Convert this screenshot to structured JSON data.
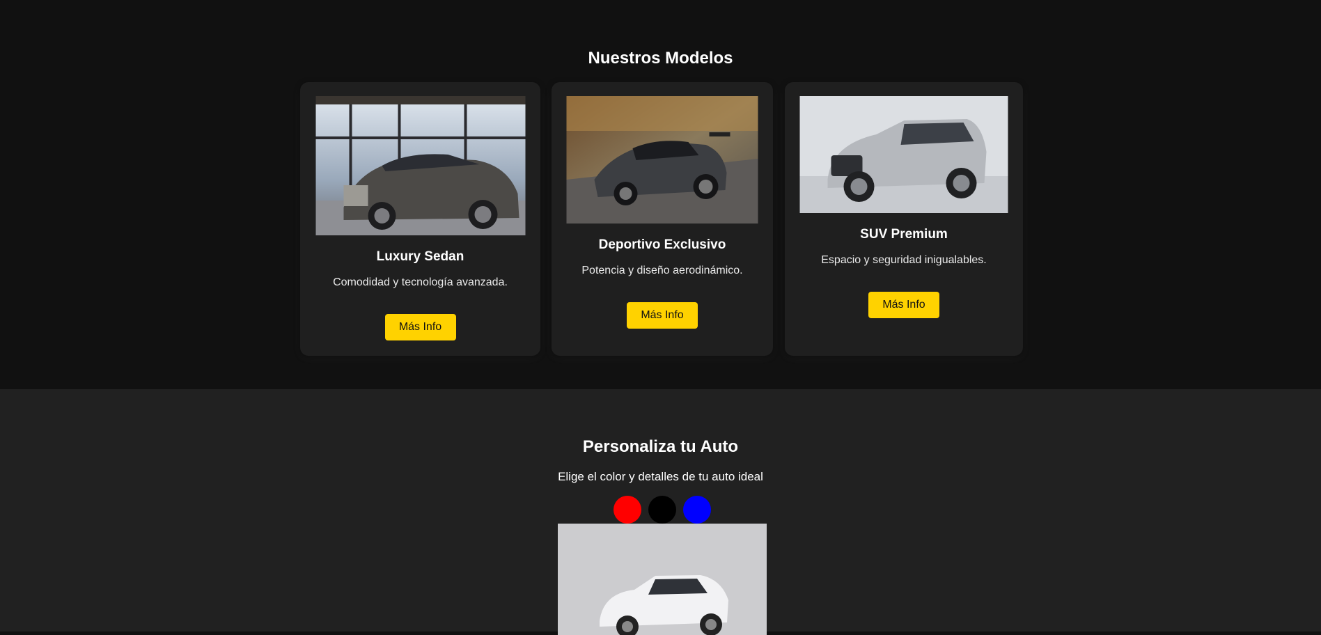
{
  "models": {
    "title": "Nuestros Modelos",
    "cards": [
      {
        "name": "Luxury Sedan",
        "desc": "Comodidad y tecnología avanzada.",
        "button": "Más Info"
      },
      {
        "name": "Deportivo Exclusivo",
        "desc": "Potencia y diseño aerodinámico.",
        "button": "Más Info"
      },
      {
        "name": "SUV Premium",
        "desc": "Espacio y seguridad inigualables.",
        "button": "Más Info"
      }
    ]
  },
  "customize": {
    "title": "Personaliza tu Auto",
    "subtitle": "Elige el color y detalles de tu auto ideal",
    "colors": [
      "#ff0000",
      "#000000",
      "#0000ff"
    ]
  }
}
